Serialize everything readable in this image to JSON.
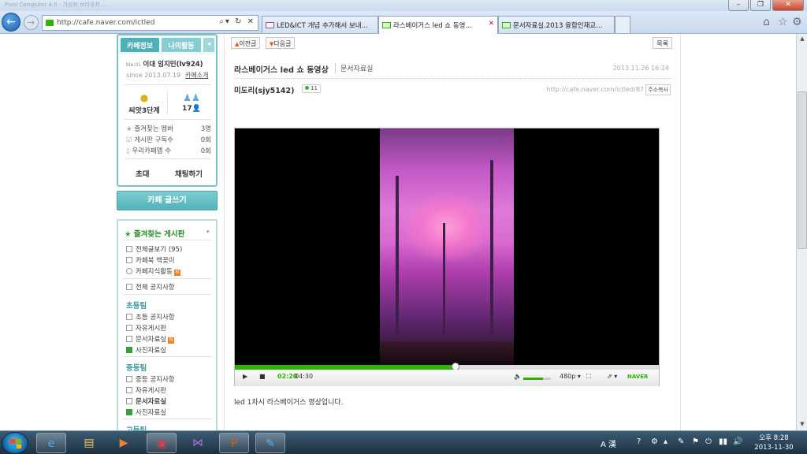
{
  "browser": {
    "window_title": "Pixel Computer 4.0 - 가상화 브라우저 ...",
    "address_url": "http://cafe.naver.com/ictled",
    "tabs": [
      {
        "label": "LED&ICT 개념 추가해서 보내...",
        "type": "mail",
        "active": false
      },
      {
        "label": "라스베이거스 led 쇼 동영...",
        "type": "cafe",
        "active": true
      },
      {
        "label": "문서자료실.2013 융합인재교...",
        "type": "cafe",
        "active": false
      }
    ]
  },
  "sidebar": {
    "tab_info": "카페정보",
    "tab_activity": "나의활동",
    "member_badge": "ble:01",
    "member_name": "이대 임지민(lv924)",
    "since": "since 2013.07.19",
    "cafe_intro": "카페소개",
    "level_name": "씨앗3단계",
    "member_count": "17",
    "stats": [
      {
        "label": "즐겨찾는 멤버",
        "value": "3명"
      },
      {
        "label": "게시판 구독수",
        "value": "0회"
      },
      {
        "label": "우리카페앱 수",
        "value": "0회"
      }
    ],
    "invite": "초대",
    "chat": "채팅하기",
    "write": "카페 글쓰기",
    "fav_boards": "즐겨찾는 게시판",
    "menu_top": [
      {
        "label": "전체글보기",
        "count": "(95)"
      },
      {
        "label": "카페북 책꽂이",
        "count": ""
      },
      {
        "label": "카페지식활동",
        "count": ""
      }
    ],
    "notice_all": "전체 공지사항",
    "groups": [
      {
        "title": "초등팀",
        "items": [
          "초등 공지사항",
          "자유게시판",
          "문서자료실",
          "사진자료실"
        ]
      },
      {
        "title": "중등팀",
        "items": [
          "중등 공지사항",
          "자유게시판",
          "문서자료실",
          "사진자료실"
        ]
      },
      {
        "title": "고등팀",
        "items": []
      }
    ]
  },
  "post": {
    "prev": "이전글",
    "next": "다음글",
    "list": "목록",
    "title": "라스베이거스 led 쇼 동영상",
    "category": "문서자료실",
    "date": "2013.11.26 16:24",
    "author": "미도리(sjy5142)",
    "comments": "11",
    "url": "http://cafe.naver.com/ictled/87",
    "copy_url": "주소복사",
    "video": {
      "current_time": "02:20",
      "total_time": "04:30",
      "progress": 0.52,
      "volume": 0.7,
      "quality": "480p",
      "brand": "NAVER"
    },
    "description": "led 1차시 라스베이거스 영상입니다."
  },
  "taskbar": {
    "ime": "A 漢",
    "clock_time": "오후 8:28",
    "clock_date": "2013-11-30"
  }
}
